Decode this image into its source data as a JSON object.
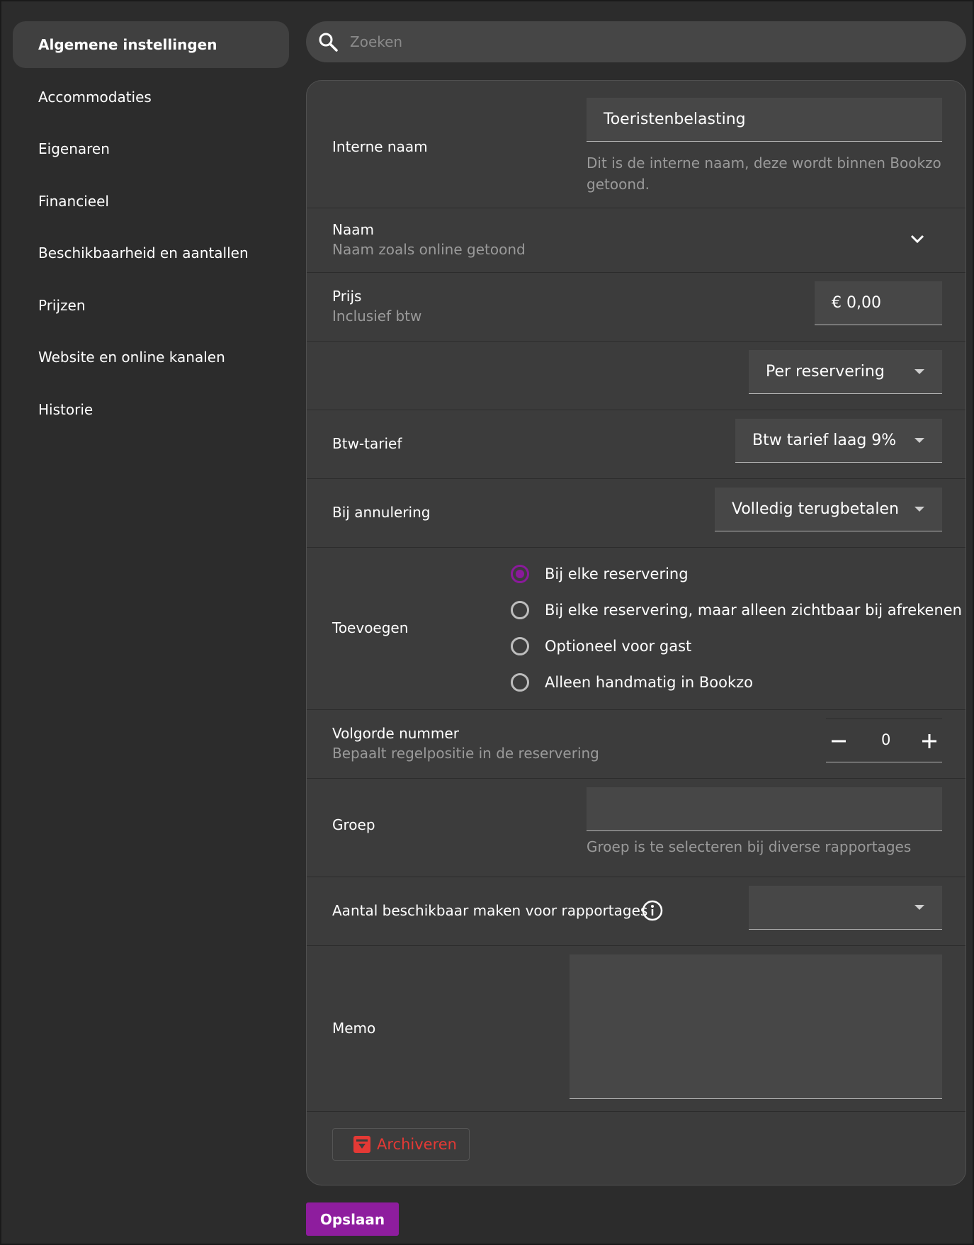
{
  "sidebar": {
    "items": [
      {
        "label": "Algemene instellingen",
        "active": true
      },
      {
        "label": "Accommodaties"
      },
      {
        "label": "Eigenaren"
      },
      {
        "label": "Financieel"
      },
      {
        "label": "Beschikbaarheid en aantallen"
      },
      {
        "label": "Prijzen"
      },
      {
        "label": "Website en online kanalen"
      },
      {
        "label": "Historie"
      }
    ]
  },
  "search": {
    "placeholder": "Zoeken"
  },
  "form": {
    "internal_name": {
      "label": "Interne naam",
      "value": "Toeristenbelasting",
      "helper": "Dit is de interne naam, deze wordt binnen Bookzo getoond."
    },
    "name": {
      "label": "Naam",
      "sublabel": "Naam zoals online getoond"
    },
    "price": {
      "label": "Prijs",
      "sublabel": "Inclusief btw",
      "value": "€ 0,00"
    },
    "per": {
      "value": "Per reservering"
    },
    "vat": {
      "label": "Btw-tarief",
      "value": "Btw tarief laag 9%"
    },
    "cancellation": {
      "label": "Bij annulering",
      "value": "Volledig terugbetalen"
    },
    "add": {
      "label": "Toevoegen",
      "options": [
        {
          "label": "Bij elke reservering",
          "checked": true
        },
        {
          "label": "Bij elke reservering, maar alleen zichtbaar bij afrekenen"
        },
        {
          "label": "Optioneel voor gast"
        },
        {
          "label": "Alleen handmatig in Bookzo"
        }
      ]
    },
    "order": {
      "label": "Volgorde nummer",
      "sublabel": "Bepaalt regelpositie in de reservering",
      "value": "0"
    },
    "group": {
      "label": "Groep",
      "value": "",
      "helper": "Groep is te selecteren bij diverse rapportages"
    },
    "reports": {
      "label": "Aantal beschikbaar maken voor rapportages",
      "value": ""
    },
    "memo": {
      "label": "Memo",
      "value": ""
    },
    "archive_label": "Archiveren"
  },
  "save_label": "Opslaan",
  "colors": {
    "accent": "#8e1d9e",
    "archive": "#e53935",
    "card": "#3c3c3c",
    "background": "#2c2c2c"
  }
}
